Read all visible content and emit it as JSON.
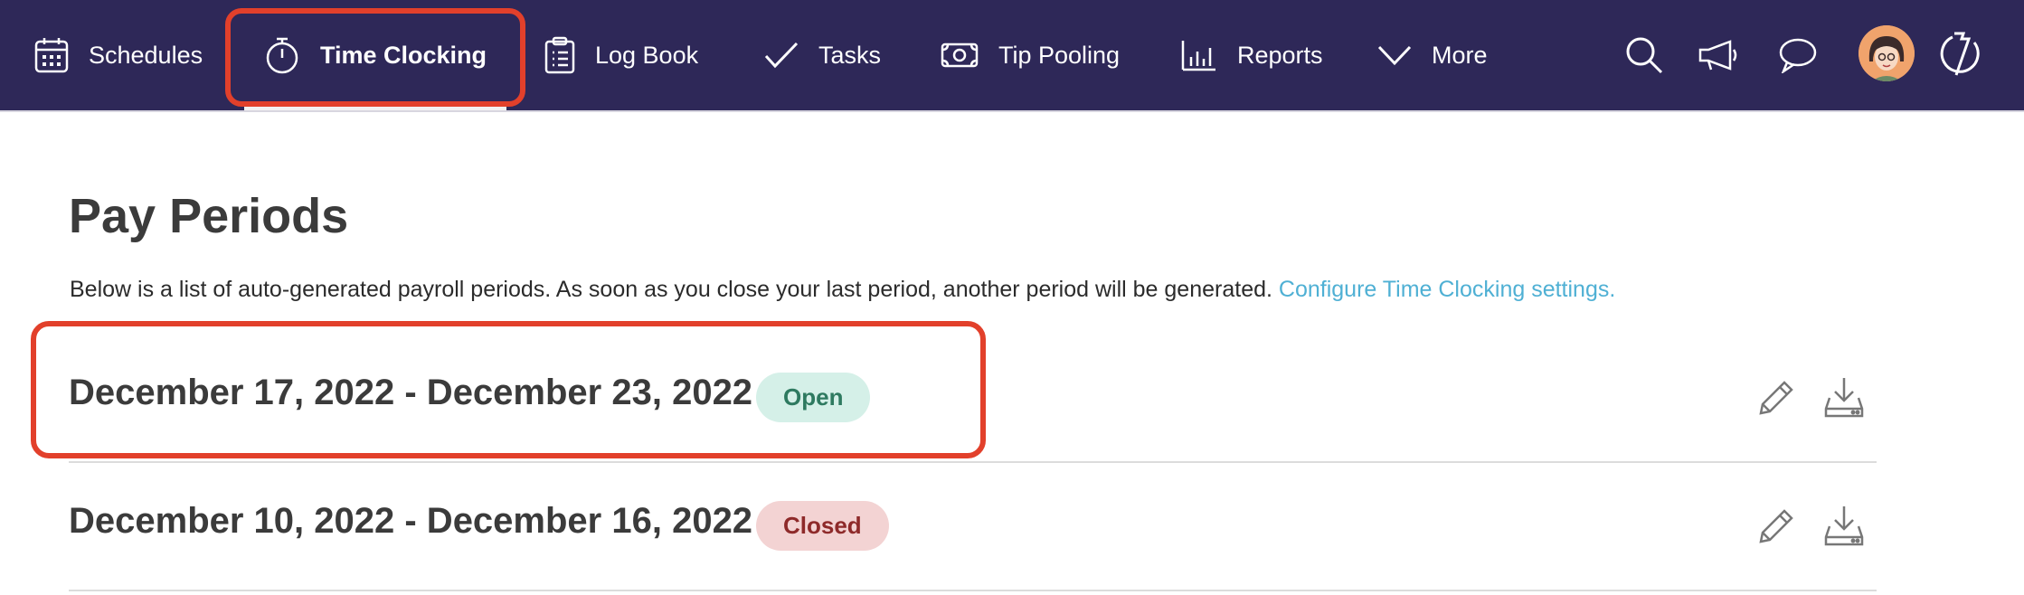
{
  "nav": {
    "items": [
      {
        "label": "Schedules",
        "icon": "calendar-icon"
      },
      {
        "label": "Time Clocking",
        "icon": "stopwatch-icon",
        "active": true
      },
      {
        "label": "Log Book",
        "icon": "clipboard-icon"
      },
      {
        "label": "Tasks",
        "icon": "checkmark-icon"
      },
      {
        "label": "Tip Pooling",
        "icon": "money-icon"
      },
      {
        "label": "Reports",
        "icon": "bar-chart-icon"
      },
      {
        "label": "More",
        "icon": "chevron-down-icon"
      }
    ],
    "right_icons": [
      "search-icon",
      "megaphone-icon",
      "chat-icon",
      "avatar",
      "logo-icon"
    ]
  },
  "page": {
    "title": "Pay Periods",
    "description": "Below is a list of auto-generated payroll periods. As soon as you close your last period, another period will be generated.",
    "settings_link": "Configure Time Clocking settings."
  },
  "periods": [
    {
      "range": "December 17, 2022 - December 23, 2022",
      "status": "Open"
    },
    {
      "range": "December 10, 2022 - December 16, 2022",
      "status": "Closed"
    }
  ],
  "colors": {
    "nav_bg": "#2e2858",
    "highlight": "#e2402b",
    "link": "#4fb0d4",
    "open_badge": "#d5f0e8",
    "closed_badge": "#f3d3d3"
  }
}
